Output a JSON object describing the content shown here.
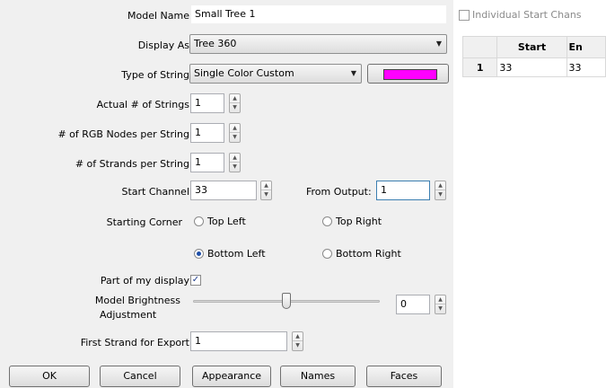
{
  "form": {
    "model_name": {
      "label": "Model Name",
      "value": "Small Tree 1"
    },
    "display_as": {
      "label": "Display As",
      "value": "Tree 360"
    },
    "type_of_string": {
      "label": "Type of String",
      "value": "Single Color Custom",
      "color": "#ff00ff"
    },
    "actual_strings": {
      "label": "Actual # of Strings",
      "value": "1"
    },
    "rgb_nodes": {
      "label": "# of RGB Nodes per String",
      "value": "1"
    },
    "strands": {
      "label": "# of Strands per String",
      "value": "1"
    },
    "start_channel": {
      "label": "Start Channel",
      "value": "33"
    },
    "from_output": {
      "label": "From Output:",
      "value": "1"
    },
    "starting_corner": {
      "label": "Starting Corner",
      "options": [
        "Top Left",
        "Top Right",
        "Bottom Left",
        "Bottom Right"
      ],
      "selected": "Bottom Left"
    },
    "part_of_display": {
      "label": "Part of my display",
      "checked": true
    },
    "brightness": {
      "label_line1": "Model Brightness",
      "label_line2": "Adjustment",
      "value": "0",
      "slider_fraction": 0.5
    },
    "first_strand": {
      "label": "First Strand for Export",
      "value": "1"
    }
  },
  "buttons": {
    "ok": "OK",
    "cancel": "Cancel",
    "appearance": "Appearance",
    "names": "Names",
    "faces": "Faces"
  },
  "channels": {
    "individual_label": "Individual Start Chans",
    "individual_checked": false,
    "columns": [
      "",
      "Start",
      "En"
    ],
    "rows": [
      {
        "num": "1",
        "start": "33",
        "end": "33"
      }
    ]
  },
  "icons": {
    "spin_up": "spin-up-arrow",
    "spin_down": "spin-down-arrow",
    "dropdown": "chevron-down-icon",
    "check": "checkmark-icon"
  }
}
